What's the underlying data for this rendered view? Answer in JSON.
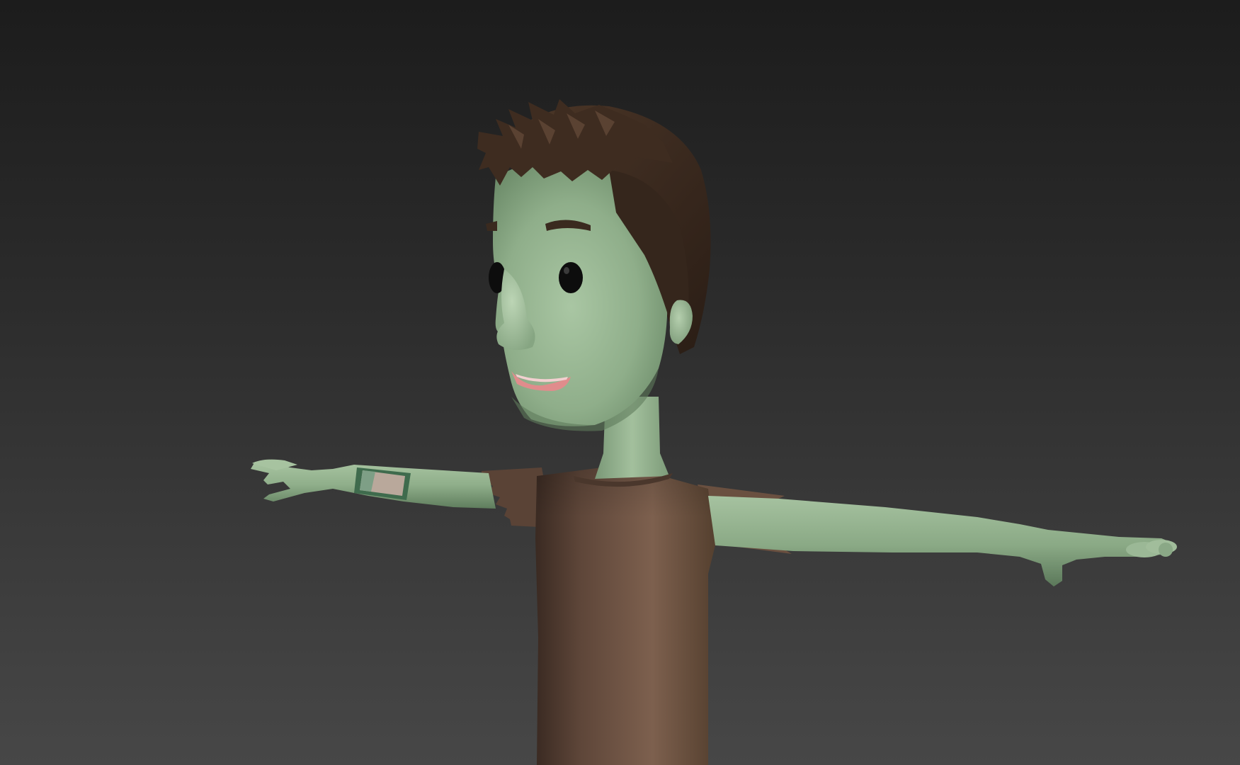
{
  "viewport": {
    "background": {
      "top_color": "#1c1c1c",
      "bottom_color": "#474747"
    }
  },
  "character": {
    "pose": "T-pose",
    "colors": {
      "skin": "#8fae8a",
      "skin_shadow": "#6d8a6a",
      "skin_highlight": "#b3cdac",
      "hair": "#3b2a1f",
      "hair_highlight": "#5a4030",
      "shirt": "#6b5142",
      "shirt_shadow": "#3e2e25",
      "shirt_highlight": "#8a6a57",
      "eye": "#0d0d0d",
      "mouth": "#e48f8f",
      "watch_band": "#4a7a5a",
      "watch_face": "#b8a79a"
    }
  }
}
